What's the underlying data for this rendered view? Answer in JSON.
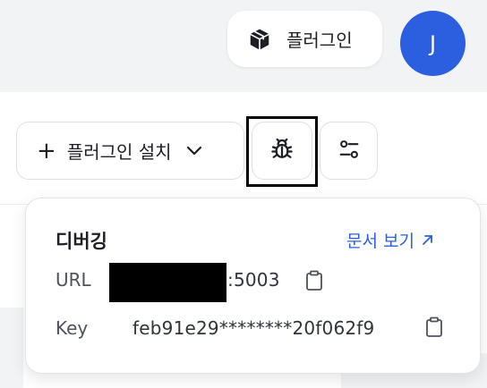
{
  "header": {
    "plugin_button_label": "플러그인",
    "plugin_icon": "package-icon",
    "avatar_initial": "J"
  },
  "toolbar": {
    "install_label": "플러그인 설치",
    "install_icon": "plus-icon",
    "dropdown_icon": "chevron-down-icon",
    "debug_icon": "bug-icon",
    "settings_icon": "sliders-icon"
  },
  "debug_panel": {
    "title": "디버깅",
    "docs_link_label": "문서 보기",
    "docs_link_icon": "arrow-up-right-icon",
    "url_label": "URL",
    "url_value_suffix": ":5003",
    "key_label": "Key",
    "key_value": "feb91e29********20f062f9",
    "copy_icon": "copy-icon"
  },
  "colors": {
    "accent": "#2b5fe0",
    "background_band": "#f2f3f5",
    "focus_outline": "#000000"
  }
}
